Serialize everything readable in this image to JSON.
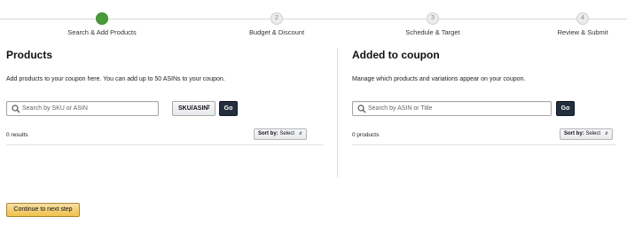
{
  "stepper": {
    "steps": [
      {
        "number": "1",
        "label": "Search & Add Products",
        "active": true
      },
      {
        "number": "2",
        "label": "Budget & Discount",
        "active": false
      },
      {
        "number": "3",
        "label": "Schedule & Target",
        "active": false
      },
      {
        "number": "4",
        "label": "Review & Submit",
        "active": false
      }
    ]
  },
  "products": {
    "title": "Products",
    "description": "Add products to your coupon here. You can add up to 50 ASINs to your coupon.",
    "search_placeholder": "Search by SKU or ASIN",
    "search_type": "SKU/ASIN",
    "go_label": "Go",
    "results_text": "0 results",
    "sort_label": "Sort by:",
    "sort_value": "Select"
  },
  "added": {
    "title": "Added to coupon",
    "description": "Manage which products and variations appear on your coupon.",
    "search_placeholder": "Search by ASIN or Title",
    "go_label": "Go",
    "results_text": "0 products",
    "sort_label": "Sort by:",
    "sort_value": "Select"
  },
  "footer": {
    "continue_label": "Continue to next step"
  },
  "colors": {
    "active_step": "#4a9a3a",
    "go_button": "#232f3e",
    "continue_button": "#f0c14b"
  }
}
